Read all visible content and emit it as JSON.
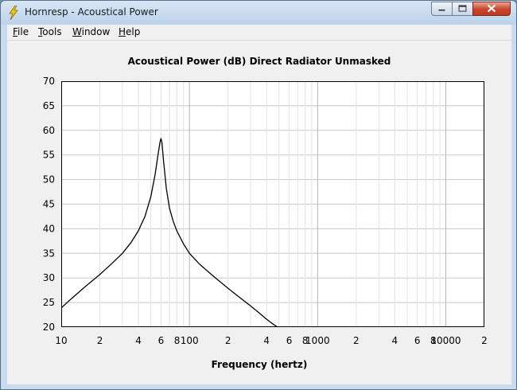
{
  "window": {
    "title": "Hornresp - Acoustical Power",
    "icon": "lightning-bolt-icon"
  },
  "menu": [
    {
      "prefix": "",
      "key": "F",
      "rest": "ile"
    },
    {
      "prefix": "",
      "key": "T",
      "rest": "ools"
    },
    {
      "prefix": "",
      "key": "W",
      "rest": "indow"
    },
    {
      "prefix": "",
      "key": "H",
      "rest": "elp"
    }
  ],
  "chart_data": {
    "type": "line",
    "title": "Acoustical Power (dB)   Direct Radiator   Unmasked",
    "xlabel": "Frequency (hertz)",
    "ylabel": "",
    "xscale": "log",
    "xlim": [
      10,
      20000
    ],
    "ylim": [
      20,
      70
    ],
    "grid": true,
    "legend": "none",
    "x_tick_labels": [
      "10",
      "2",
      "4",
      "6",
      "8",
      "100",
      "2",
      "4",
      "6",
      "8",
      "1000",
      "2",
      "4",
      "6",
      "8",
      "10000",
      "2"
    ],
    "y_tick_labels": [
      "70",
      "65",
      "60",
      "55",
      "50",
      "45",
      "40",
      "35",
      "30",
      "25",
      "20"
    ],
    "line_color": "#000000",
    "series": [
      {
        "x": [
          10,
          12,
          15,
          20,
          25,
          30,
          35,
          40,
          45,
          50,
          54,
          57,
          59,
          60,
          61,
          63,
          66,
          70,
          75,
          80,
          90,
          100,
          120,
          150,
          200,
          250,
          300,
          350,
          400,
          450,
          500
        ],
        "y": [
          23.9,
          25.8,
          28.0,
          30.7,
          33.0,
          35.0,
          37.2,
          39.6,
          42.5,
          46.5,
          51.0,
          55.2,
          57.6,
          58.4,
          57.5,
          53.5,
          48.2,
          44.1,
          41.4,
          39.5,
          36.9,
          35.0,
          32.8,
          30.6,
          27.9,
          25.9,
          24.3,
          22.9,
          21.6,
          20.6,
          19.8
        ]
      }
    ]
  }
}
